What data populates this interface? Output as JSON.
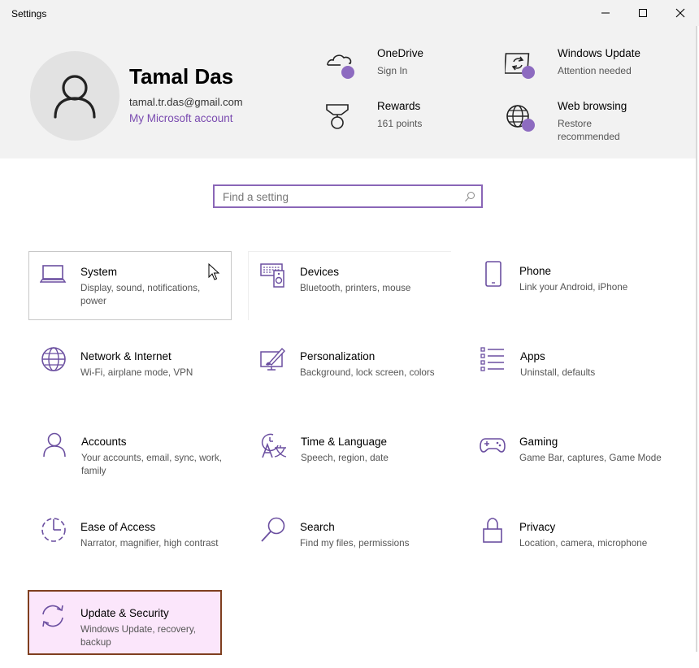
{
  "window": {
    "title": "Settings"
  },
  "user": {
    "name": "Tamal Das",
    "email": "tamal.tr.das@gmail.com",
    "account_link": "My Microsoft account"
  },
  "header_items": [
    {
      "title": "OneDrive",
      "subtitle": "Sign In",
      "icon": "onedrive-icon"
    },
    {
      "title": "Windows Update",
      "subtitle": "Attention needed",
      "icon": "windows-update-icon"
    },
    {
      "title": "Rewards",
      "subtitle": "161 points",
      "icon": "rewards-icon"
    },
    {
      "title": "Web browsing",
      "subtitle": "Restore recommended",
      "icon": "web-browsing-icon"
    }
  ],
  "search": {
    "placeholder": "Find a setting"
  },
  "tiles": [
    {
      "title": "System",
      "desc": "Display, sound, notifications, power",
      "icon": "laptop-icon"
    },
    {
      "title": "Devices",
      "desc": "Bluetooth, printers, mouse",
      "icon": "devices-icon"
    },
    {
      "title": "Phone",
      "desc": "Link your Android, iPhone",
      "icon": "phone-icon"
    },
    {
      "title": "Network & Internet",
      "desc": "Wi-Fi, airplane mode, VPN",
      "icon": "globe-icon"
    },
    {
      "title": "Personalization",
      "desc": "Background, lock screen, colors",
      "icon": "personalization-icon"
    },
    {
      "title": "Apps",
      "desc": "Uninstall, defaults",
      "icon": "apps-icon"
    },
    {
      "title": "Accounts",
      "desc": "Your accounts, email, sync, work, family",
      "icon": "person-icon"
    },
    {
      "title": "Time & Language",
      "desc": "Speech, region, date",
      "icon": "time-language-icon"
    },
    {
      "title": "Gaming",
      "desc": "Game Bar, captures, Game Mode",
      "icon": "gamepad-icon"
    },
    {
      "title": "Ease of Access",
      "desc": "Narrator, magnifier, high contrast",
      "icon": "ease-of-access-icon"
    },
    {
      "title": "Search",
      "desc": "Find my files, permissions",
      "icon": "search-icon"
    },
    {
      "title": "Privacy",
      "desc": "Location, camera, microphone",
      "icon": "lock-icon"
    },
    {
      "title": "Update & Security",
      "desc": "Windows Update, recovery, backup",
      "icon": "update-icon"
    }
  ],
  "colors": {
    "accent": "#7a4bb0",
    "icon": "#6b4fa0",
    "badge": "#8d6bc0",
    "highlight_border": "#7f3f1f"
  }
}
